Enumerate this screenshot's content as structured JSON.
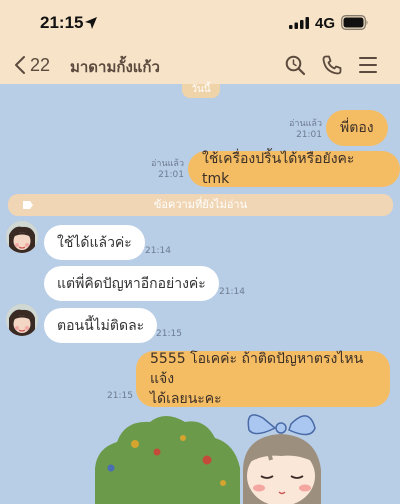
{
  "status_bar": {
    "time": "21:15",
    "network": "4G"
  },
  "header": {
    "back_count": "22",
    "title": "มาดามกั้งแก้ว"
  },
  "chat": {
    "date_label": "วันนี้",
    "unread_label": "ข้อความที่ยังไม่อ่าน",
    "messages": [
      {
        "side": "out",
        "text": "พี่ตอง",
        "read": "อ่านแล้ว",
        "time": "21:01"
      },
      {
        "side": "out",
        "text": "ใช้เครื่องปริ้นได้หรือยังคะ tmk",
        "read": "อ่านแล้ว",
        "time": "21:01"
      },
      {
        "side": "in",
        "text": "ใช้ได้แล้วค่ะ",
        "time": "21:14"
      },
      {
        "side": "in",
        "text": "แต่พี่คิดปัญหาอีกอย่างค่ะ",
        "time": "21:14"
      },
      {
        "side": "in",
        "text": "ตอนนี้ไม่ติดละ",
        "time": "21:15"
      },
      {
        "side": "out",
        "text_line1": "5555  โอเคค่ะ ถ้าติดปัญหาตรงไหนแจ้ง",
        "text_line2": "ได้เลยนะคะ",
        "time": "21:15"
      }
    ]
  },
  "colors": {
    "chat_bg": "#b8cde6",
    "header_bg": "#f7e3c7",
    "outgoing_bubble": "#f5bd63",
    "incoming_bubble": "#ffffff"
  },
  "icons": [
    "location-arrow-icon",
    "signal-icon",
    "battery-icon",
    "back-chevron-icon",
    "search-icon",
    "phone-icon",
    "menu-icon",
    "tag-icon"
  ]
}
